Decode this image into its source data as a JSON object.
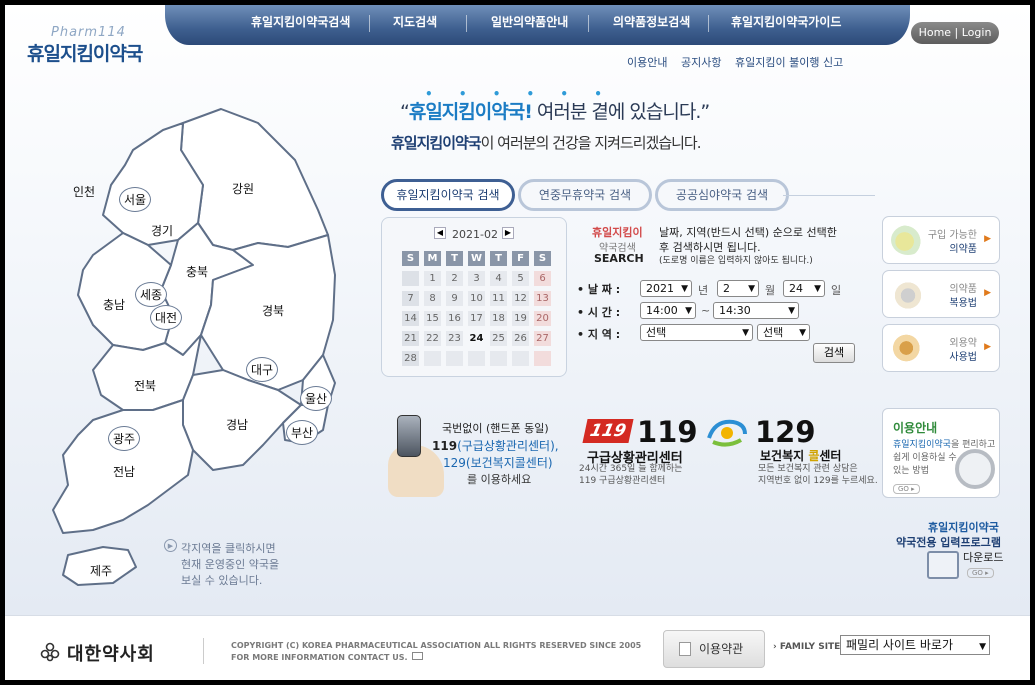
{
  "logo": {
    "sub": "Pharm114",
    "main": "휴일지킴이약국"
  },
  "nav": {
    "items": [
      "휴일지킴이약국검색",
      "지도검색",
      "일반의약품안내",
      "의약품정보검색",
      "휴일지킴이약국가이드"
    ],
    "home_login": "Home | Login",
    "sub_links": [
      "이용안내",
      "공지사항",
      "휴일지킴이 불이행 신고"
    ]
  },
  "headline": {
    "dots": "• • • • • •",
    "open_quote": "“",
    "brand": "휴일지킴이약국",
    "bang": "!",
    "rest": " 여러분 곁에 있습니다.”",
    "sub_brand": "휴일지킴이약국",
    "sub_rest": "이 여러분의 건강을 지켜드리겠습니다."
  },
  "map": {
    "regions": [
      "인천",
      "서울",
      "경기",
      "강원",
      "충북",
      "세종",
      "충남",
      "대전",
      "경북",
      "대구",
      "전북",
      "울산",
      "경남",
      "부산",
      "광주",
      "전남",
      "제주"
    ],
    "hint": [
      "각지역을 클릭하시면",
      "현재 운영중인 약국을",
      "보실 수 있습니다."
    ]
  },
  "tabs": [
    "휴일지킴이약국 검색",
    "연중무휴약국 검색",
    "공공심야약국 검색"
  ],
  "calendar": {
    "month_label": "2021-02",
    "weekdays": [
      "S",
      "M",
      "T",
      "W",
      "T",
      "F",
      "S"
    ],
    "weeks": [
      [
        "",
        "1",
        "2",
        "3",
        "4",
        "5",
        "6"
      ],
      [
        "7",
        "8",
        "9",
        "10",
        "11",
        "12",
        "13"
      ],
      [
        "14",
        "15",
        "16",
        "17",
        "18",
        "19",
        "20"
      ],
      [
        "21",
        "22",
        "23",
        "24",
        "25",
        "26",
        "27"
      ],
      [
        "28",
        "",
        "",
        "",
        "",
        "",
        ""
      ]
    ],
    "today": "24"
  },
  "search": {
    "title1": "휴일지킴이",
    "title2": "약국검색",
    "title3": "SEARCH",
    "instr1": "날짜, 지역(반드시 선택) 순으로 선택한",
    "instr2": "후 검색하시면 됩니다.",
    "instr3": "(도로명 이름은 입력하지 않아도 됩니다.)",
    "date_label": "• 날 짜 :",
    "time_label": "• 시 간 :",
    "region_label": "• 지 역 :",
    "year": "2021",
    "year_unit": "년",
    "month": "2",
    "month_unit": "월",
    "day": "24",
    "day_unit": "일",
    "time_from": "14:00",
    "time_sep": "~",
    "time_to": "14:30",
    "region": "선택",
    "subregion": "선택",
    "button": "검색"
  },
  "side": [
    {
      "t1": "구입 가능한",
      "t2": "의약품"
    },
    {
      "t1": "의약품",
      "t2": "복용법"
    },
    {
      "t1": "외용약",
      "t2": "사용법"
    }
  ],
  "phone": {
    "line1": "국번없이 (핸드폰 동일)",
    "line2_num": "119",
    "line2_rest": "(구급상황관리센터),",
    "line3": "129(보건복지콜센터)",
    "line4": "를 이용하세요"
  },
  "c119": {
    "logo": "119",
    "num": "119",
    "title": "구급상황관리센터",
    "desc1": "24시간 365일 늘 함께하는",
    "desc2": "119 구급상황관리센터"
  },
  "c129": {
    "num": "129",
    "title_pre": "보건복지 ",
    "title_em": "콜",
    "title_post": "센터",
    "desc1": "모든 보건복지 관련 상담은",
    "desc2": "지역번호 없이 129를 누르세요."
  },
  "usage": {
    "title": "이용안내",
    "line1_em": "휴일지킴이약국",
    "line1_rest": "을 편리하고",
    "line2": "쉽게 이용하실 수",
    "line3": "있는 방법",
    "go": "GO ▸"
  },
  "download": {
    "line1": "휴일지킴이약국",
    "line2": "약국전용 입력프로그램",
    "line3": "다운로드",
    "go": "GO ▸"
  },
  "footer": {
    "org": "대한약사회",
    "copy1": "COPYRIGHT (C) KOREA PHARMACEUTICAL ASSOCIATION ALL RIGHTS RESERVED SINCE 2005",
    "copy2": "FOR MORE INFORMATION CONTACT US.",
    "terms": "이용약관",
    "family_label": "FAMILY SITE",
    "family_select": "패밀리 사이트 바로가"
  },
  "colors": {
    "nav": "#3e5f8f",
    "brand": "#1b7cc4",
    "accent": "#d42a22"
  }
}
